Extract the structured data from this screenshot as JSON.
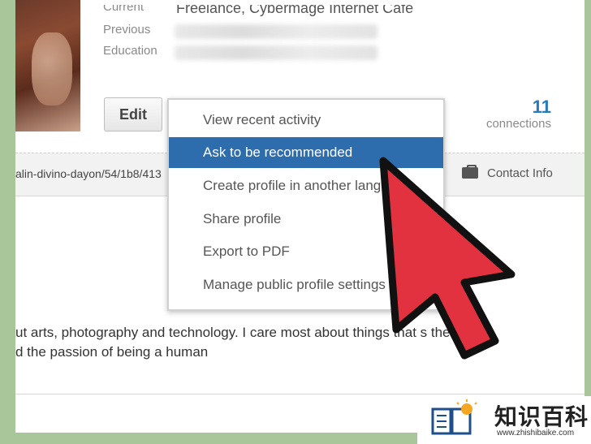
{
  "profile": {
    "current_label": "Current",
    "current_value": "Freelance, Cybermage Internet Cafe",
    "previous_label": "Previous",
    "education_label": "Education",
    "edit_button": "Edit",
    "connections_count": "11",
    "connections_label": "connections",
    "public_url": "alin-divino-dayon/54/1b8/413",
    "contact_info": "Contact Info",
    "about_line1": "ut arts, photography and technology. I care most about things that      s the",
    "about_line2": "d the passion of being a human"
  },
  "menu": {
    "items": [
      {
        "label": "View recent activity"
      },
      {
        "label": "Ask to be recommended"
      },
      {
        "label": "Create profile in another lang"
      },
      {
        "label": "Share profile"
      },
      {
        "label": "Export to PDF"
      },
      {
        "label": "Manage public profile settings"
      }
    ]
  },
  "watermark": {
    "title": "知识百科",
    "url": "www.zhishibaike.com"
  },
  "colors": {
    "background": "#a9c59a",
    "highlight": "#2d6cad",
    "arrow": "#e2323f",
    "link": "#2a79b8"
  }
}
